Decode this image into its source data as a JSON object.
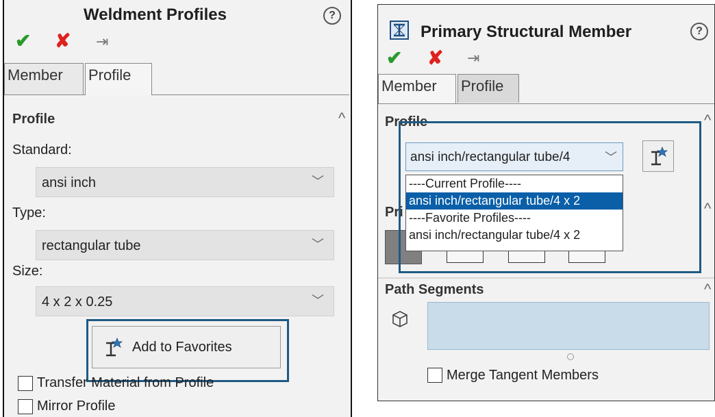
{
  "left_panel": {
    "title": "Weldment Profiles",
    "help": "?",
    "tabs": [
      "Member",
      "Profile"
    ],
    "section": "Profile",
    "standard_label": "Standard:",
    "standard_value": "ansi inch",
    "type_label": "Type:",
    "type_value": "rectangular tube",
    "size_label": "Size:",
    "size_value": "4 x 2 x 0.25",
    "add_button": "Add to Favorites",
    "transfer_label": "Transfer Material from Profile",
    "mirror_label": "Mirror Profile"
  },
  "right_panel": {
    "title": "Primary Structural Member",
    "help": "?",
    "tabs": [
      "Member",
      "Profile"
    ],
    "section": "Profile",
    "combo_value": "ansi inch/rectangular tube/4",
    "dropdown_items": [
      "----Current Profile----",
      "ansi inch/rectangular tube/4 x 2",
      "----Favorite Profiles----",
      "ansi inch/rectangular tube/4 x 2"
    ],
    "hidden_section_prefix": "Pri",
    "path_segments": "Path Segments",
    "merge_label": "Merge Tangent Members"
  },
  "colors": {
    "highlight_border": "#1e5a84",
    "selected_item": "#0a5fa8",
    "check": "#2b9a2b",
    "cross": "#e0201d"
  }
}
